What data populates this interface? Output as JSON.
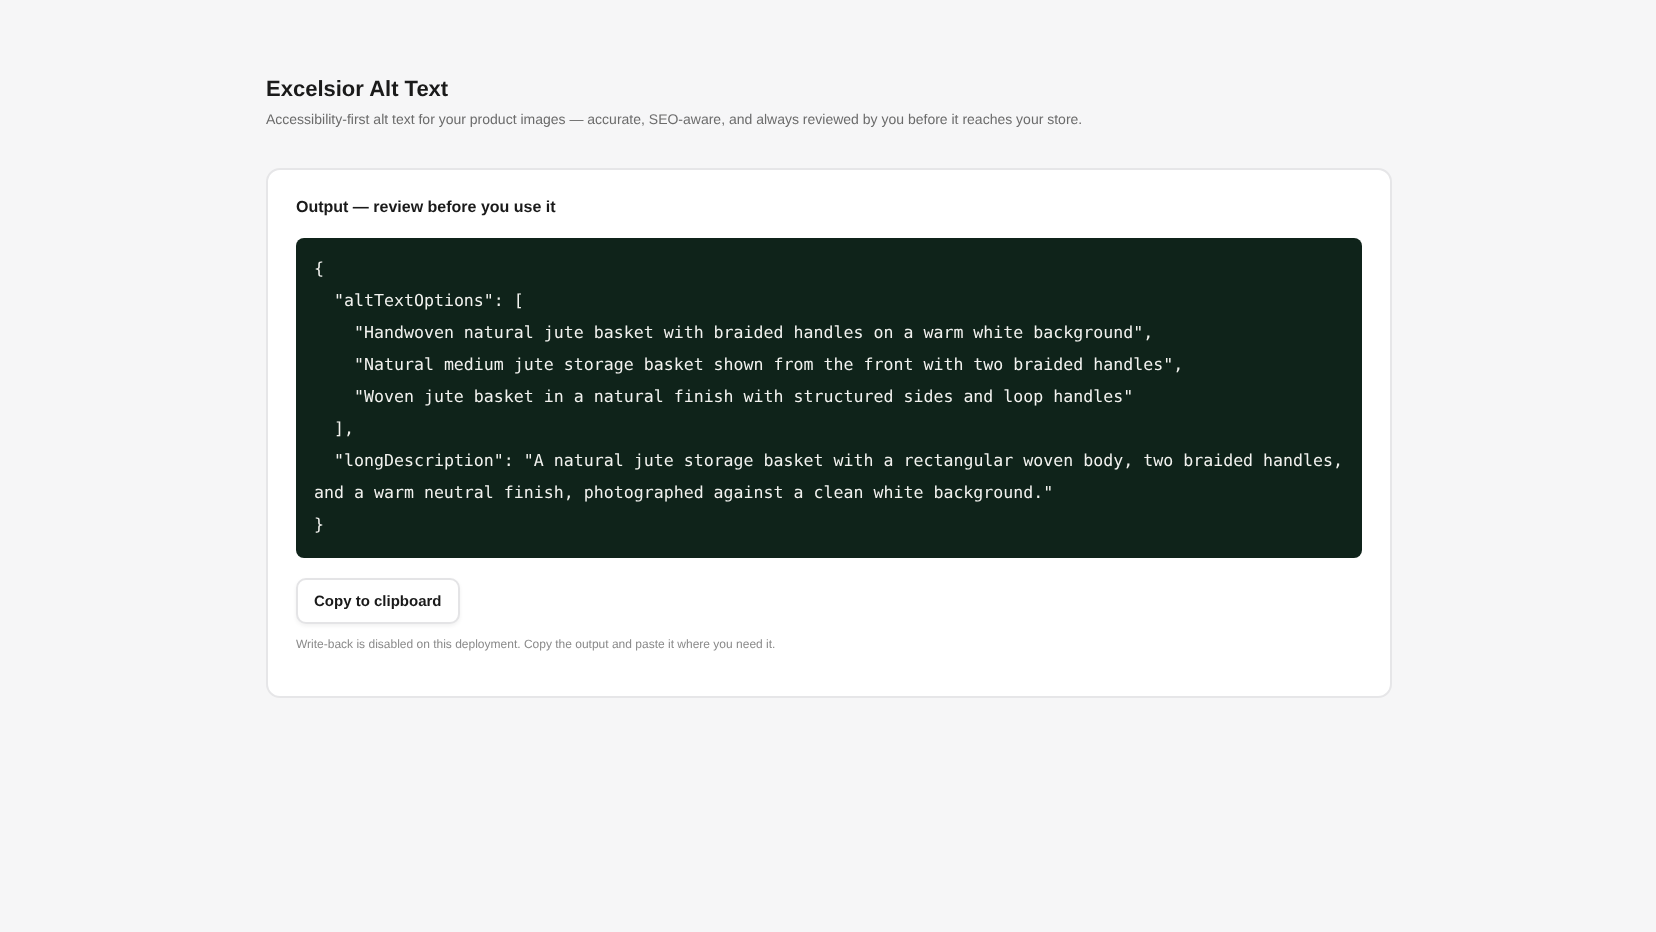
{
  "header": {
    "title": "Excelsior Alt Text",
    "subtitle": "Accessibility-first alt text for your product images — accurate, SEO-aware, and always reviewed by you before it reaches your store."
  },
  "output": {
    "label": "Output — review before you use it",
    "code_lines": [
      "{",
      "  \"altTextOptions\": [",
      "    \"Handwoven natural jute basket with braided handles on a warm white background\",",
      "    \"Natural medium jute storage basket shown from the front with two braided handles\",",
      "    \"Woven jute basket in a natural finish with structured sides and loop handles\"",
      "  ],",
      "  \"longDescription\": \"A natural jute storage basket with a rectangular woven body, two braided handles, and a warm neutral finish, photographed against a clean white background.\"",
      "}"
    ],
    "copy_button": "Copy to clipboard",
    "note": "Write-back is disabled on this deployment. Copy the output and paste it where you need it."
  }
}
